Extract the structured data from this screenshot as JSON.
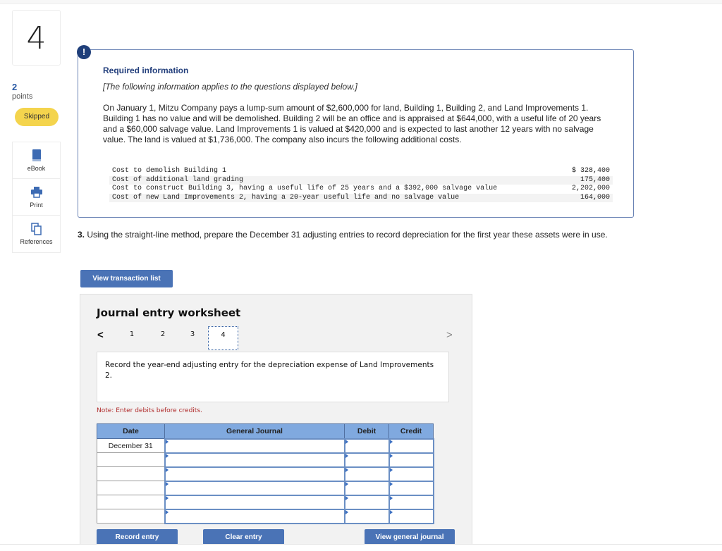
{
  "question": {
    "number": "4",
    "points_value": "2",
    "points_label": "points",
    "status": "Skipped"
  },
  "tools": [
    {
      "icon": "book-icon",
      "label": "eBook"
    },
    {
      "icon": "printer-icon",
      "label": "Print"
    },
    {
      "icon": "copy-icon",
      "label": "References"
    }
  ],
  "info": {
    "alert_icon": "!",
    "title": "Required information",
    "subtitle": "[The following information applies to the questions displayed below.]",
    "body": "On January 1, Mitzu Company pays a lump-sum amount of $2,600,000 for land, Building 1, Building 2, and Land Improvements 1. Building 1 has no value and will be demolished. Building 2 will be an office and is appraised at $644,000, with a useful life of 20 years and a $60,000 salvage value. Land Improvements 1 is valued at $420,000 and is expected to last another 12 years with no salvage value. The land is valued at $1,736,000. The company also incurs the following additional costs.",
    "costs": [
      {
        "label": "Cost to demolish Building 1",
        "amount": "$ 328,400"
      },
      {
        "label": "Cost of additional land grading",
        "amount": "175,400"
      },
      {
        "label": "Cost to construct Building 3, having a useful life of 25 years and a $392,000 salvage value",
        "amount": "2,202,000"
      },
      {
        "label": "Cost of new Land Improvements 2, having a 20-year useful life and no salvage value",
        "amount": "164,000"
      }
    ]
  },
  "prompt": {
    "number": "3.",
    "text": " Using the straight-line method, prepare the December 31 adjusting entries to record depreciation for the first year these assets were in use."
  },
  "buttons": {
    "view_transaction_list": "View transaction list",
    "record_entry": "Record entry",
    "clear_entry": "Clear entry",
    "view_general_journal": "View general journal"
  },
  "worksheet": {
    "title": "Journal entry worksheet",
    "prev": "<",
    "next": ">",
    "tabs": [
      "1",
      "2",
      "3",
      "4"
    ],
    "active_tab": "4",
    "description": "Record the year-end adjusting entry for the depreciation expense of Land Improvements 2.",
    "note": "Note: Enter debits before credits.",
    "columns": [
      "Date",
      "General Journal",
      "Debit",
      "Credit"
    ],
    "rows": [
      {
        "date": "December 31",
        "account": "",
        "debit": "",
        "credit": ""
      },
      {
        "date": "",
        "account": "",
        "debit": "",
        "credit": ""
      },
      {
        "date": "",
        "account": "",
        "debit": "",
        "credit": ""
      },
      {
        "date": "",
        "account": "",
        "debit": "",
        "credit": ""
      },
      {
        "date": "",
        "account": "",
        "debit": "",
        "credit": ""
      },
      {
        "date": "",
        "account": "",
        "debit": "",
        "credit": ""
      }
    ]
  },
  "colors": {
    "accent": "#4a73b6",
    "skipped_badge": "#f4d44d",
    "table_header": "#80a9df",
    "note": "#b02a2a"
  }
}
